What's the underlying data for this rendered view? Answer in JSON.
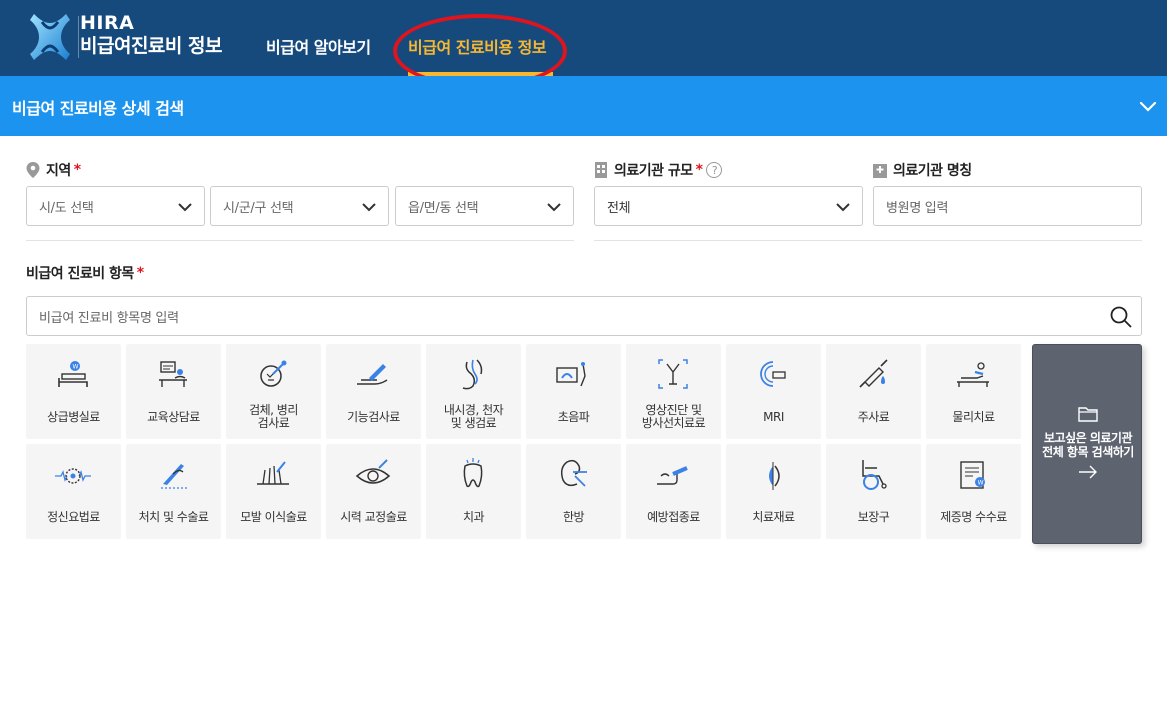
{
  "header": {
    "logo_line1": "HIRA",
    "logo_line2": "비급여진료비 정보",
    "nav": [
      "비급여 알아보기",
      "비급여 진료비용 정보"
    ]
  },
  "search_bar": {
    "title": "비급여 진료비용 상세 검색"
  },
  "region": {
    "label": "지역",
    "required": "*",
    "selects": [
      "시/도 선택",
      "시/군/구 선택",
      "읍/면/동 선택"
    ]
  },
  "scale": {
    "label": "의료기관 규모",
    "required": "*",
    "help": "?",
    "value": "전체"
  },
  "hospital": {
    "label": "의료기관 명칭",
    "placeholder": "병원명 입력"
  },
  "item": {
    "label": "비급여 진료비 항목",
    "required": "*",
    "placeholder": "비급여 진료비 항목명 입력"
  },
  "categories": [
    {
      "label": "상급병실료",
      "icon": "bed-icon"
    },
    {
      "label": "교육상담료",
      "icon": "consult-icon"
    },
    {
      "label": "검체, 병리\n검사료",
      "icon": "specimen-icon"
    },
    {
      "label": "기능검사료",
      "icon": "function-test-icon"
    },
    {
      "label": "내시경, 천자\n및 생검료",
      "icon": "endoscope-icon"
    },
    {
      "label": "초음파",
      "icon": "ultrasound-icon"
    },
    {
      "label": "영상진단 및\n방사선치료료",
      "icon": "imaging-icon"
    },
    {
      "label": "MRI",
      "icon": "mri-icon"
    },
    {
      "label": "주사료",
      "icon": "syringe-icon"
    },
    {
      "label": "물리치료",
      "icon": "physio-icon"
    },
    {
      "label": "정신요법료",
      "icon": "brain-icon"
    },
    {
      "label": "처치 및 수술료",
      "icon": "surgery-icon"
    },
    {
      "label": "모발 이식술료",
      "icon": "hair-icon"
    },
    {
      "label": "시력 교정술료",
      "icon": "eye-icon"
    },
    {
      "label": "치과",
      "icon": "tooth-icon"
    },
    {
      "label": "한방",
      "icon": "acupuncture-icon"
    },
    {
      "label": "예방접종료",
      "icon": "vaccine-icon"
    },
    {
      "label": "치료재료",
      "icon": "material-icon"
    },
    {
      "label": "보장구",
      "icon": "wheelchair-icon"
    },
    {
      "label": "제증명 수수료",
      "icon": "certificate-icon"
    }
  ],
  "all_items": {
    "label": "보고싶은 의료기관\n전체 항목 검색하기"
  },
  "colors": {
    "header": "#164a7d",
    "bar": "#1c93ee",
    "accent": "#f7b731",
    "highlight": "#e0141e"
  }
}
